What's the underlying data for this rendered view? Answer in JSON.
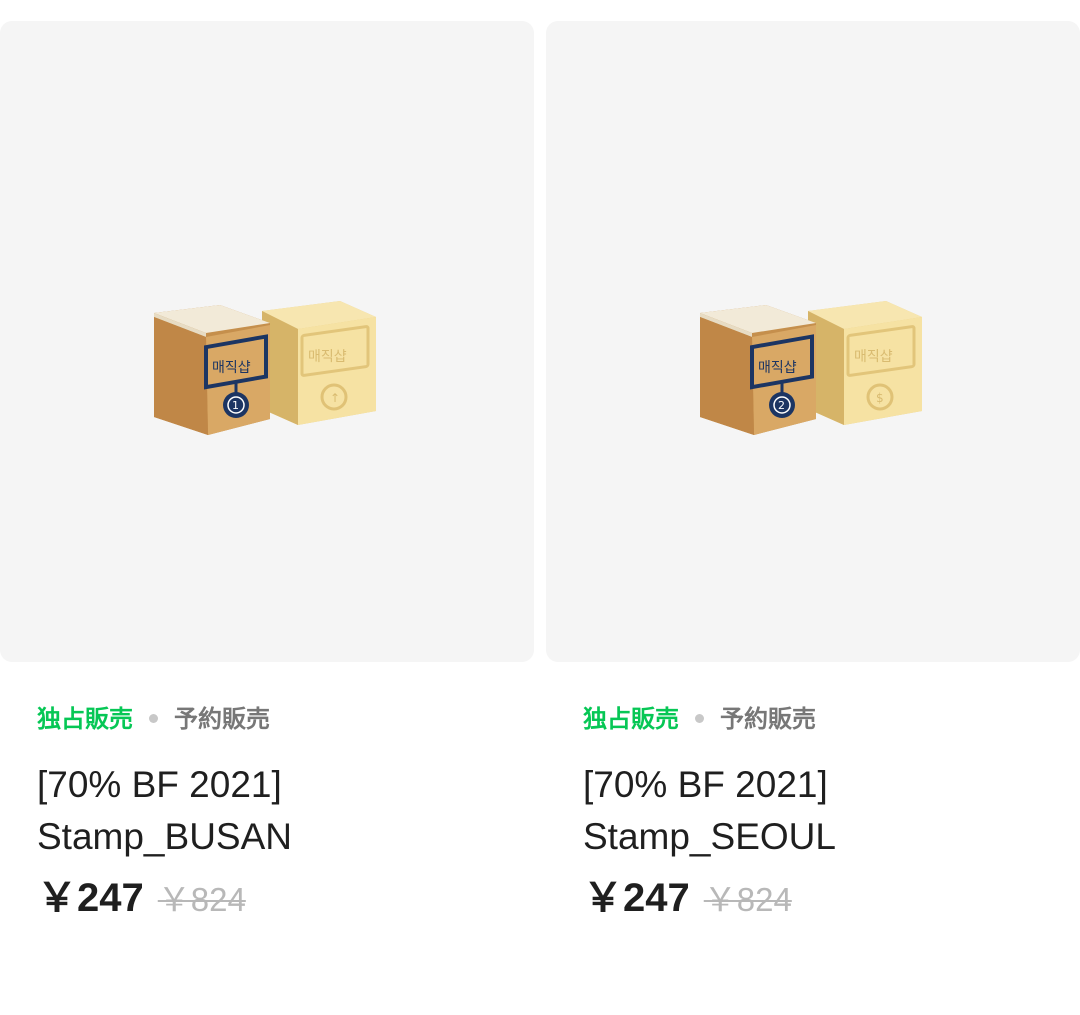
{
  "products": [
    {
      "tag_exclusive": "独占販売",
      "tag_preorder": "予約販売",
      "title_line1": "[70% BF 2021]",
      "title_line2": "Stamp_BUSAN",
      "price": "￥247",
      "original_price": "￥824",
      "stamp_number": "1",
      "stamp_text": "매직샵",
      "stamp_symbol": "↑"
    },
    {
      "tag_exclusive": "独占販売",
      "tag_preorder": "予約販売",
      "title_line1": "[70% BF 2021]",
      "title_line2": "Stamp_SEOUL",
      "price": "￥247",
      "original_price": "￥824",
      "stamp_number": "2",
      "stamp_text": "매직샵",
      "stamp_symbol": "$"
    }
  ],
  "colors": {
    "exclusive_tag": "#06c755",
    "thumbnail_bg": "#f5f5f5",
    "box_kraft": "#d9a865",
    "box_cream": "#f4dfa0",
    "stamp_navy": "#1c3563"
  }
}
